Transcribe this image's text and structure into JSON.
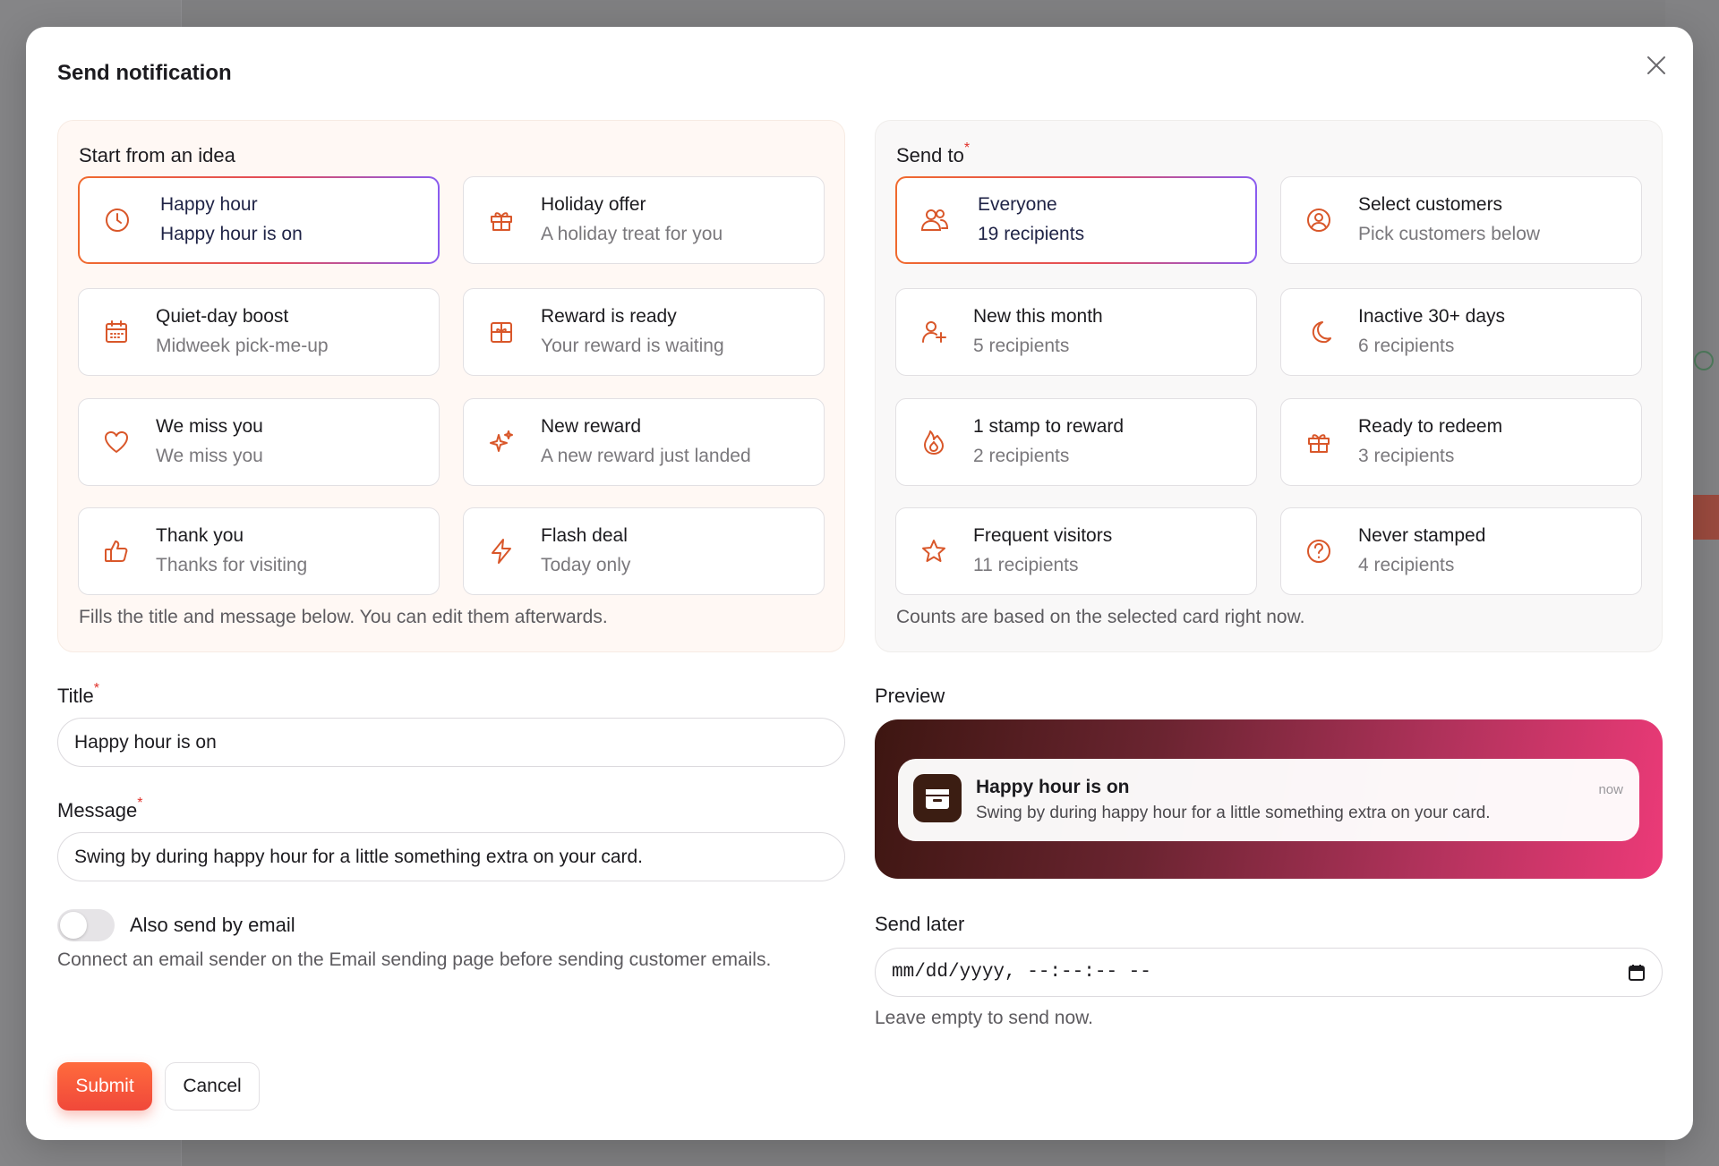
{
  "dialog": {
    "title": "Send notification"
  },
  "ideas": {
    "label": "Start from an idea",
    "hint": "Fills the title and message below. You can edit them afterwards.",
    "items": [
      {
        "title": "Happy hour",
        "subtitle": "Happy hour is on",
        "icon": "clock-icon",
        "selected": true
      },
      {
        "title": "Holiday offer",
        "subtitle": "A holiday treat for you",
        "icon": "gift-icon"
      },
      {
        "title": "Quiet-day boost",
        "subtitle": "Midweek pick-me-up",
        "icon": "calendar-icon"
      },
      {
        "title": "Reward is ready",
        "subtitle": "Your reward is waiting",
        "icon": "gift-box-icon"
      },
      {
        "title": "We miss you",
        "subtitle": "We miss you",
        "icon": "heart-icon"
      },
      {
        "title": "New reward",
        "subtitle": "A new reward just landed",
        "icon": "sparkles-icon"
      },
      {
        "title": "Thank you",
        "subtitle": "Thanks for visiting",
        "icon": "thumbs-up-icon"
      },
      {
        "title": "Flash deal",
        "subtitle": "Today only",
        "icon": "lightning-icon"
      }
    ]
  },
  "sendto": {
    "label": "Send to",
    "required": "*",
    "hint": "Counts are based on the selected card right now.",
    "items": [
      {
        "title": "Everyone",
        "subtitle": "19 recipients",
        "icon": "users-icon",
        "selected": true
      },
      {
        "title": "Select customers",
        "subtitle": "Pick customers below",
        "icon": "user-circle-icon"
      },
      {
        "title": "New this month",
        "subtitle": "5 recipients",
        "icon": "user-plus-icon"
      },
      {
        "title": "Inactive 30+ days",
        "subtitle": "6 recipients",
        "icon": "moon-icon"
      },
      {
        "title": "1 stamp to reward",
        "subtitle": "2 recipients",
        "icon": "flame-icon"
      },
      {
        "title": "Ready to redeem",
        "subtitle": "3 recipients",
        "icon": "gift-icon"
      },
      {
        "title": "Frequent visitors",
        "subtitle": "11 recipients",
        "icon": "star-icon"
      },
      {
        "title": "Never stamped",
        "subtitle": "4 recipients",
        "icon": "question-circle-icon"
      }
    ]
  },
  "form": {
    "title_label": "Title",
    "title_required": "*",
    "title_value": "Happy hour is on",
    "message_label": "Message",
    "message_required": "*",
    "message_value": "Swing by during happy hour for a little something extra on your card.",
    "email_toggle_label": "Also send by email",
    "email_toggle_on": false,
    "email_hint": "Connect an email sender on the Email sending page before sending customer emails."
  },
  "preview": {
    "label": "Preview",
    "notif_title": "Happy hour is on",
    "notif_message": "Swing by during happy hour for a little something extra on your card.",
    "notif_time": "now"
  },
  "schedule": {
    "label": "Send later",
    "placeholder": "mm/dd/yyyy, --:--:-- --",
    "hint": "Leave empty to send now."
  },
  "actions": {
    "submit": "Submit",
    "cancel": "Cancel"
  },
  "colors": {
    "accent": "#f05a32",
    "icon": "#d9572a",
    "selected_gradient_end": "#8a5cf0"
  }
}
